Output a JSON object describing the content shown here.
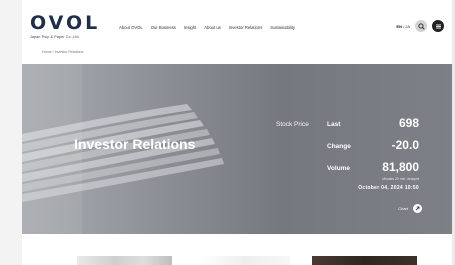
{
  "brand": {
    "logo_text": "OVOL",
    "company_name": "Japan Pulp & Paper Co.,Ltd."
  },
  "nav": {
    "items": [
      {
        "label": "About OVOL"
      },
      {
        "label": "Our Business"
      },
      {
        "label": "Insight"
      },
      {
        "label": "About us"
      },
      {
        "label": "Investor Relations"
      },
      {
        "label": "Sustainability"
      }
    ]
  },
  "header_actions": {
    "lang_en": "EN",
    "lang_ja": "JA",
    "search_icon": "search-icon",
    "menu_icon": "menu-icon"
  },
  "breadcrumb": {
    "home": "Home",
    "current": "Investor Relations"
  },
  "hero": {
    "title": "Investor Relations"
  },
  "stock": {
    "caption": "Stock Price",
    "last_label": "Last",
    "last_value": "698",
    "change_label": "Change",
    "change_value": "-20.0",
    "volume_label": "Volume",
    "volume_value": "81,800",
    "note": "Minutes 20 min. delayed",
    "date": "October 04, 2024 10:50",
    "chart_label": "Chart",
    "chart_icon": "arrow-right-icon"
  },
  "colors": {
    "brand_navy": "#1f2f4a",
    "hero_gray": "#7d8087"
  }
}
